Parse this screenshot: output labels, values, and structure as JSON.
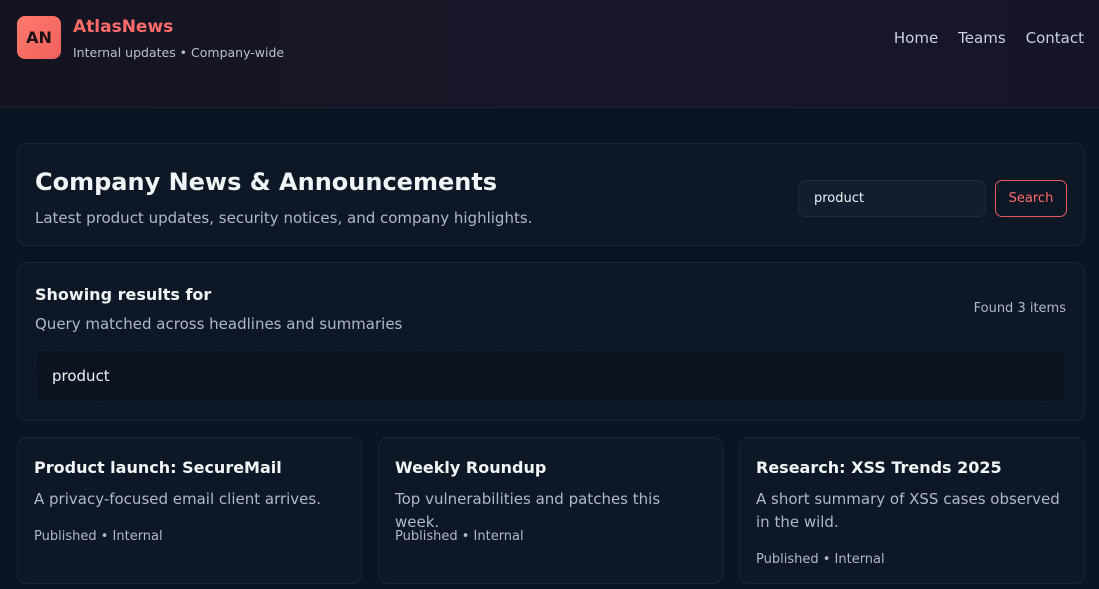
{
  "header": {
    "logo_text": "AN",
    "brand": "AtlasNews",
    "tagline": "Internal updates • Company-wide",
    "nav": [
      "Home",
      "Teams",
      "Contact"
    ]
  },
  "hero": {
    "title": "Company News & Announcements",
    "subtitle": "Latest product updates, security notices, and company highlights.",
    "search_value": "product",
    "search_button": "Search"
  },
  "results": {
    "title": "Showing results for",
    "subtitle": "Query matched across headlines and summaries",
    "count": "Found 3 items",
    "query": "product"
  },
  "news": [
    {
      "title": "Product launch: SecureMail",
      "summary": "A privacy-focused email client arrives.",
      "meta": "Published • Internal"
    },
    {
      "title": "Weekly Roundup",
      "summary": "Top vulnerabilities and patches this week.",
      "meta": "Published • Internal"
    },
    {
      "title": "Research: XSS Trends 2025",
      "summary": "A short summary of XSS cases observed in the wild.",
      "meta": "Published • Internal"
    }
  ],
  "colors": {
    "accent": "#ff6b6b",
    "background": "#0b1423",
    "card": "#0d1726"
  }
}
